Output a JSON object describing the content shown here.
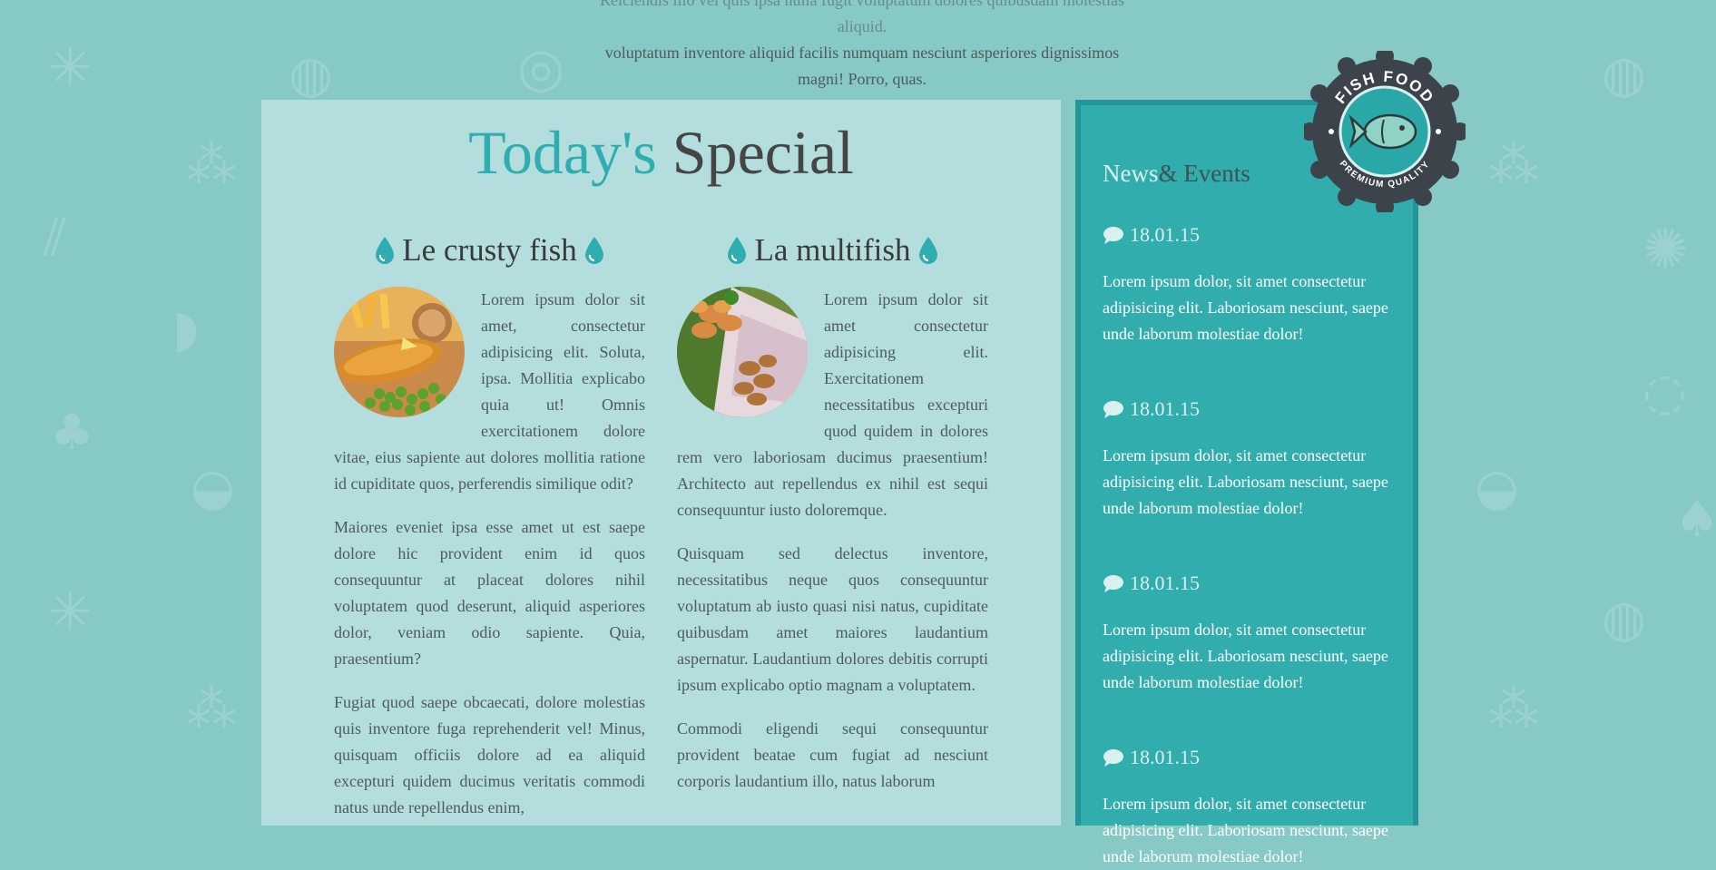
{
  "intro": {
    "line1": "Reiciendis illo vel quis ipsa nulla fugit voluptatum dolores quibusdam molestias aliquid.",
    "line2": "voluptatum inventore aliquid facilis numquam nesciunt asperiores dignissimos",
    "line3": "magni! Porro, quas."
  },
  "special": {
    "title_accent": "Today's",
    "title_rest": "Special"
  },
  "dishes": [
    {
      "name": "Le crusty fish",
      "image_icon": "fish-and-chips-photo",
      "paragraphs": [
        "Lorem ipsum dolor sit amet, consectetur adipisicing elit. Soluta, ipsa. Mollitia explicabo quia ut! Omnis exercitationem dolore vitae, eius sapiente aut dolores mollitia ratione id cupiditate quos, perferendis similique odit?",
        "Maiores eveniet ipsa esse amet ut est saepe dolore hic provident enim id quos consequuntur at placeat dolores nihil voluptatem quod deserunt, aliquid asperiores dolor, veniam odio sapiente. Quia, praesentium?",
        "Fugiat quod saepe obcaecati, dolore molestias quis inventore fuga reprehenderit vel! Minus, quisquam officiis dolore ad ea aliquid excepturi quidem ducimus veritatis commodi natus unde repellendus enim,"
      ]
    },
    {
      "name": "La multifish",
      "image_icon": "fried-seafood-photo",
      "paragraphs": [
        "Lorem ipsum dolor sit amet consectetur adipisicing elit. Exercitationem necessitatibus excepturi quod quidem in dolores rem vero laboriosam ducimus praesentium! Architecto aut repellendus ex nihil est sequi consequuntur iusto doloremque.",
        "Quisquam sed delectus inventore, necessitatibus neque quos consequuntur voluptatum ab iusto quasi nisi natus, cupiditate quibusdam amet maiores laudantium aspernatur. Laudantium dolores debitis corrupti ipsum explicabo optio magnam a voluptatem.",
        "Commodi eligendi sequi consequuntur provident beatae cum fugiat ad nesciunt corporis laudantium illo, natus laborum"
      ]
    }
  ],
  "sidebar": {
    "title_news": "News",
    "title_events": "& Events",
    "events": [
      {
        "date": "18.01.15",
        "text": "Lorem ipsum dolor, sit amet consectetur adipisicing elit. Laboriosam nesciunt, saepe unde laborum molestiae dolor!"
      },
      {
        "date": "18.01.15",
        "text": "Lorem ipsum dolor, sit amet consectetur adipisicing elit. Laboriosam nesciunt, saepe unde laborum molestiae dolor!"
      },
      {
        "date": "18.01.15",
        "text": "Lorem ipsum dolor, sit amet consectetur adipisicing elit. Laboriosam nesciunt, saepe unde laborum molestiae dolor!"
      },
      {
        "date": "18.01.15",
        "text": "Lorem ipsum dolor, sit amet consectetur adipisicing elit. Laboriosam nesciunt, saepe unde laborum molestiae dolor!"
      }
    ]
  },
  "badge": {
    "top_text": "FISH FOOD",
    "bottom_text": "PREMIUM QUALITY"
  },
  "colors": {
    "background": "#86c9c5",
    "panel": "#b3dedd",
    "accent": "#2fadb0",
    "sidebar": "#31adae",
    "badge_dark": "#3d434b"
  }
}
